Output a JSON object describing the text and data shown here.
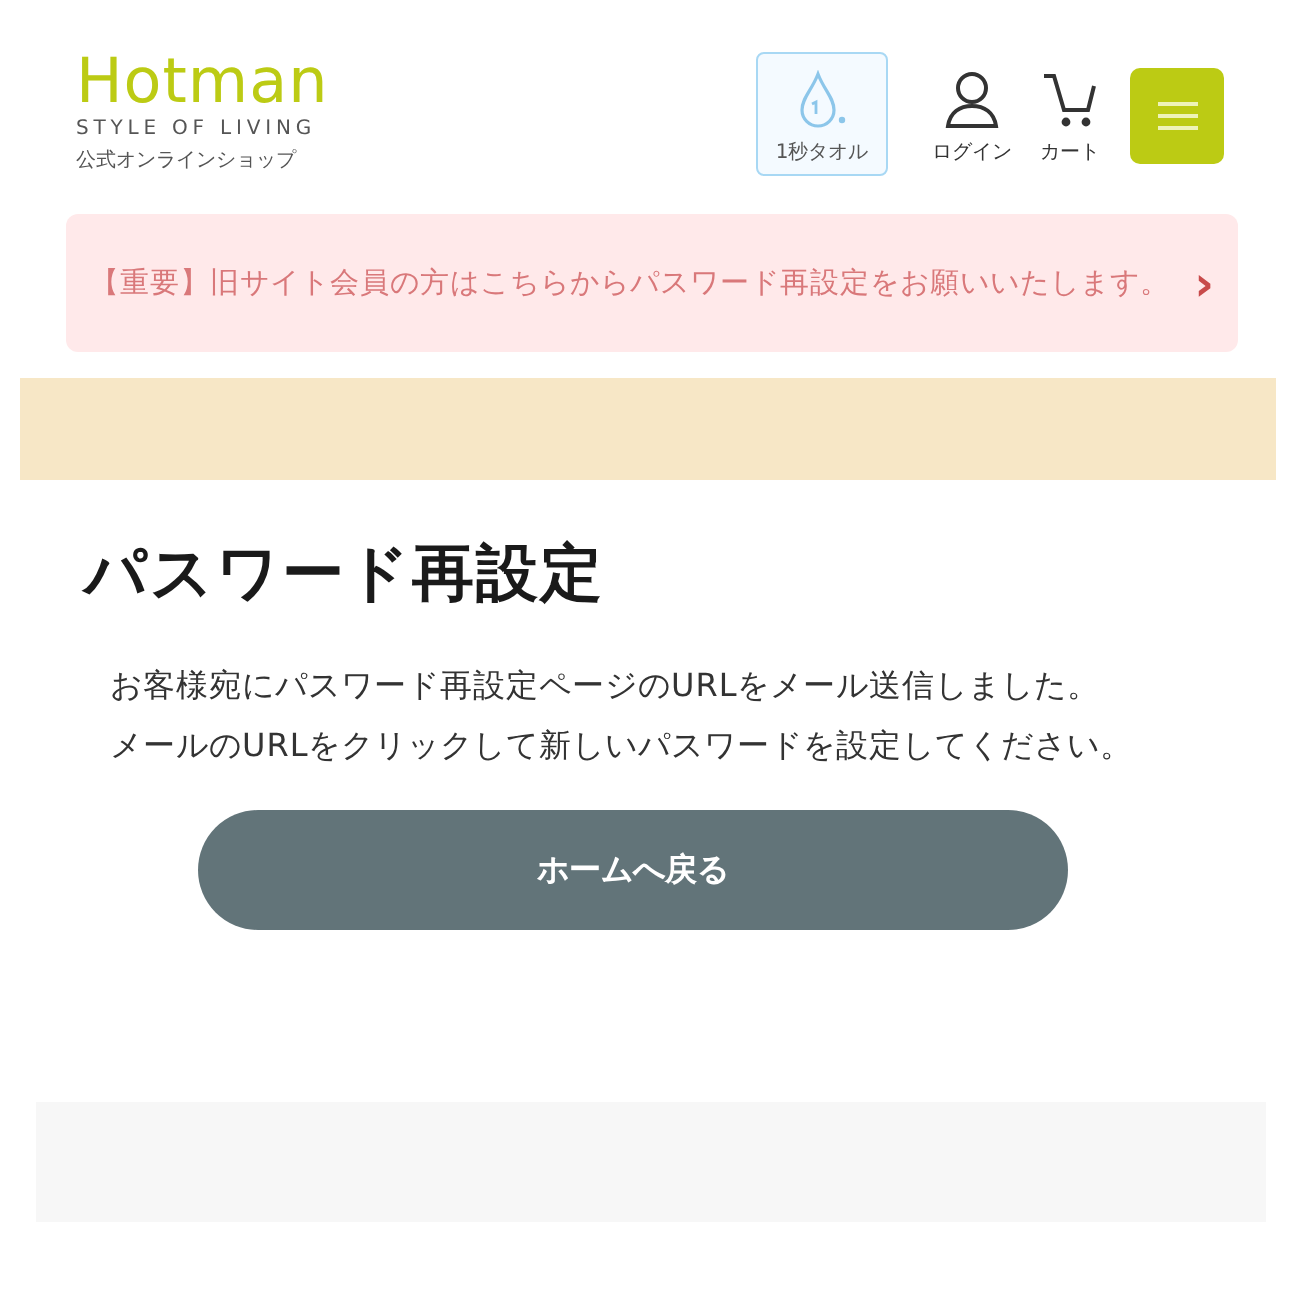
{
  "header": {
    "logo": {
      "name": "Hotman",
      "tagline": "STYLE OF LIVING",
      "subtitle": "公式オンラインショップ"
    },
    "nav": [
      {
        "kind": "towel",
        "label": "1秒タオル"
      },
      {
        "kind": "user",
        "label": "ログイン"
      },
      {
        "kind": "cart",
        "label": "カート"
      }
    ]
  },
  "notice": {
    "text": "【重要】旧サイト会員の方はこちらからパスワード再設定をお願いいたします。",
    "arrow": "›"
  },
  "page": {
    "title": "パスワード再設定",
    "paragraphs": [
      "お客様宛にパスワード再設定ページのURLをメール送信しました。",
      "メールのURLをクリックして新しいパスワードを設定してください。"
    ],
    "button": "ホームへ戻る"
  }
}
